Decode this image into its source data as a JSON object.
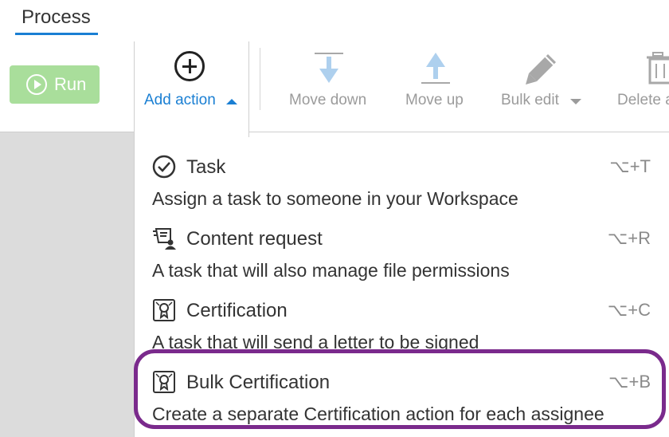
{
  "tabs": {
    "active_label": "Process"
  },
  "toolbar": {
    "run_label": "Run",
    "add_action_label": "Add action",
    "move_down_label": "Move down",
    "move_up_label": "Move up",
    "bulk_edit_label": "Bulk edit",
    "delete_label": "Delete a"
  },
  "menu": {
    "items": [
      {
        "title": "Task",
        "shortcut": "⌥+T",
        "description": "Assign a task to someone in your Workspace",
        "icon": "check-circle-icon"
      },
      {
        "title": "Content request",
        "shortcut": "⌥+R",
        "description": "A task that will also manage file permissions",
        "icon": "content-request-icon"
      },
      {
        "title": "Certification",
        "shortcut": "⌥+C",
        "description": "A task that will send a letter to be signed",
        "icon": "certificate-icon"
      },
      {
        "title": "Bulk Certification",
        "shortcut": "⌥+B",
        "description": "Create a separate Certification action for each assignee",
        "icon": "certificate-icon"
      }
    ]
  },
  "colors": {
    "accent": "#1a7fd3",
    "run_button": "#a9de9b",
    "disabled_text": "#9b9b9b",
    "highlight_ring": "#7a2a8c",
    "background_grey": "#dcdcdc"
  }
}
